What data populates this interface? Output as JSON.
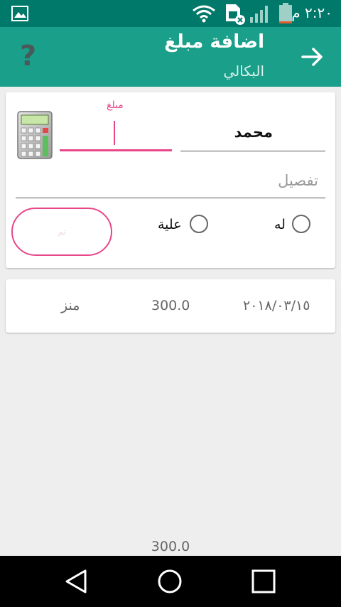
{
  "status_bar": {
    "time": "٢:٢٠ م",
    "icons": [
      "image-icon",
      "wifi-icon",
      "sim-icon",
      "signal-icon",
      "battery-icon"
    ],
    "color": "#00796b"
  },
  "app_bar": {
    "title": "اضافة مبلغ",
    "subtitle": "البكالي",
    "help_label": "?",
    "color": "#1a9f8a"
  },
  "form": {
    "amount_label": "مبلغ",
    "amount_value": "",
    "name_value": "محمد",
    "detail_placeholder": "تفصيل",
    "radio_for_label": "له",
    "radio_against_label": "علية",
    "ok_label": "تم",
    "accent": "#e8468a"
  },
  "entries": [
    {
      "date": "٢٠١٨/٠٣/١٥",
      "amount": "300.0",
      "type": "منز"
    }
  ],
  "total": "300.0"
}
